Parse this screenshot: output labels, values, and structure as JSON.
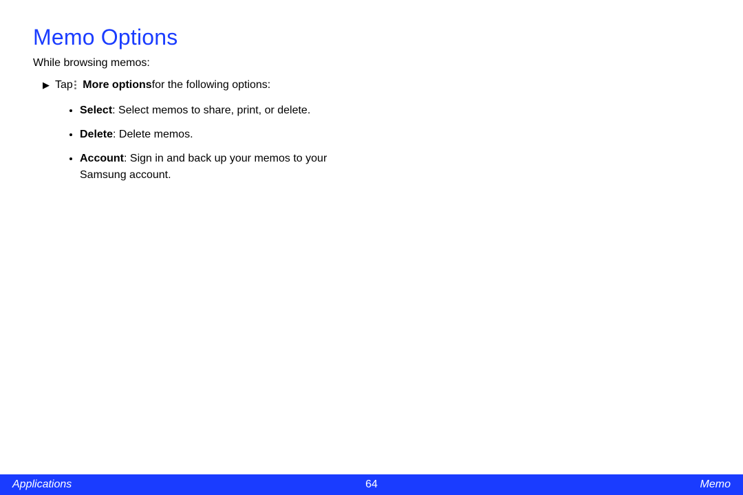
{
  "title": "Memo Options",
  "intro": "While browsing memos:",
  "step": {
    "prefix": "Tap ",
    "bold": "More options",
    "suffix": " for the following options:"
  },
  "bullets": [
    {
      "term": "Select",
      "desc": ": Select memos to share, print, or delete."
    },
    {
      "term": "Delete",
      "desc": ": Delete memos."
    },
    {
      "term": "Account",
      "desc": ": Sign in and back up your memos to your Samsung account."
    }
  ],
  "footer": {
    "left": "Applications",
    "center": "64",
    "right": "Memo"
  }
}
